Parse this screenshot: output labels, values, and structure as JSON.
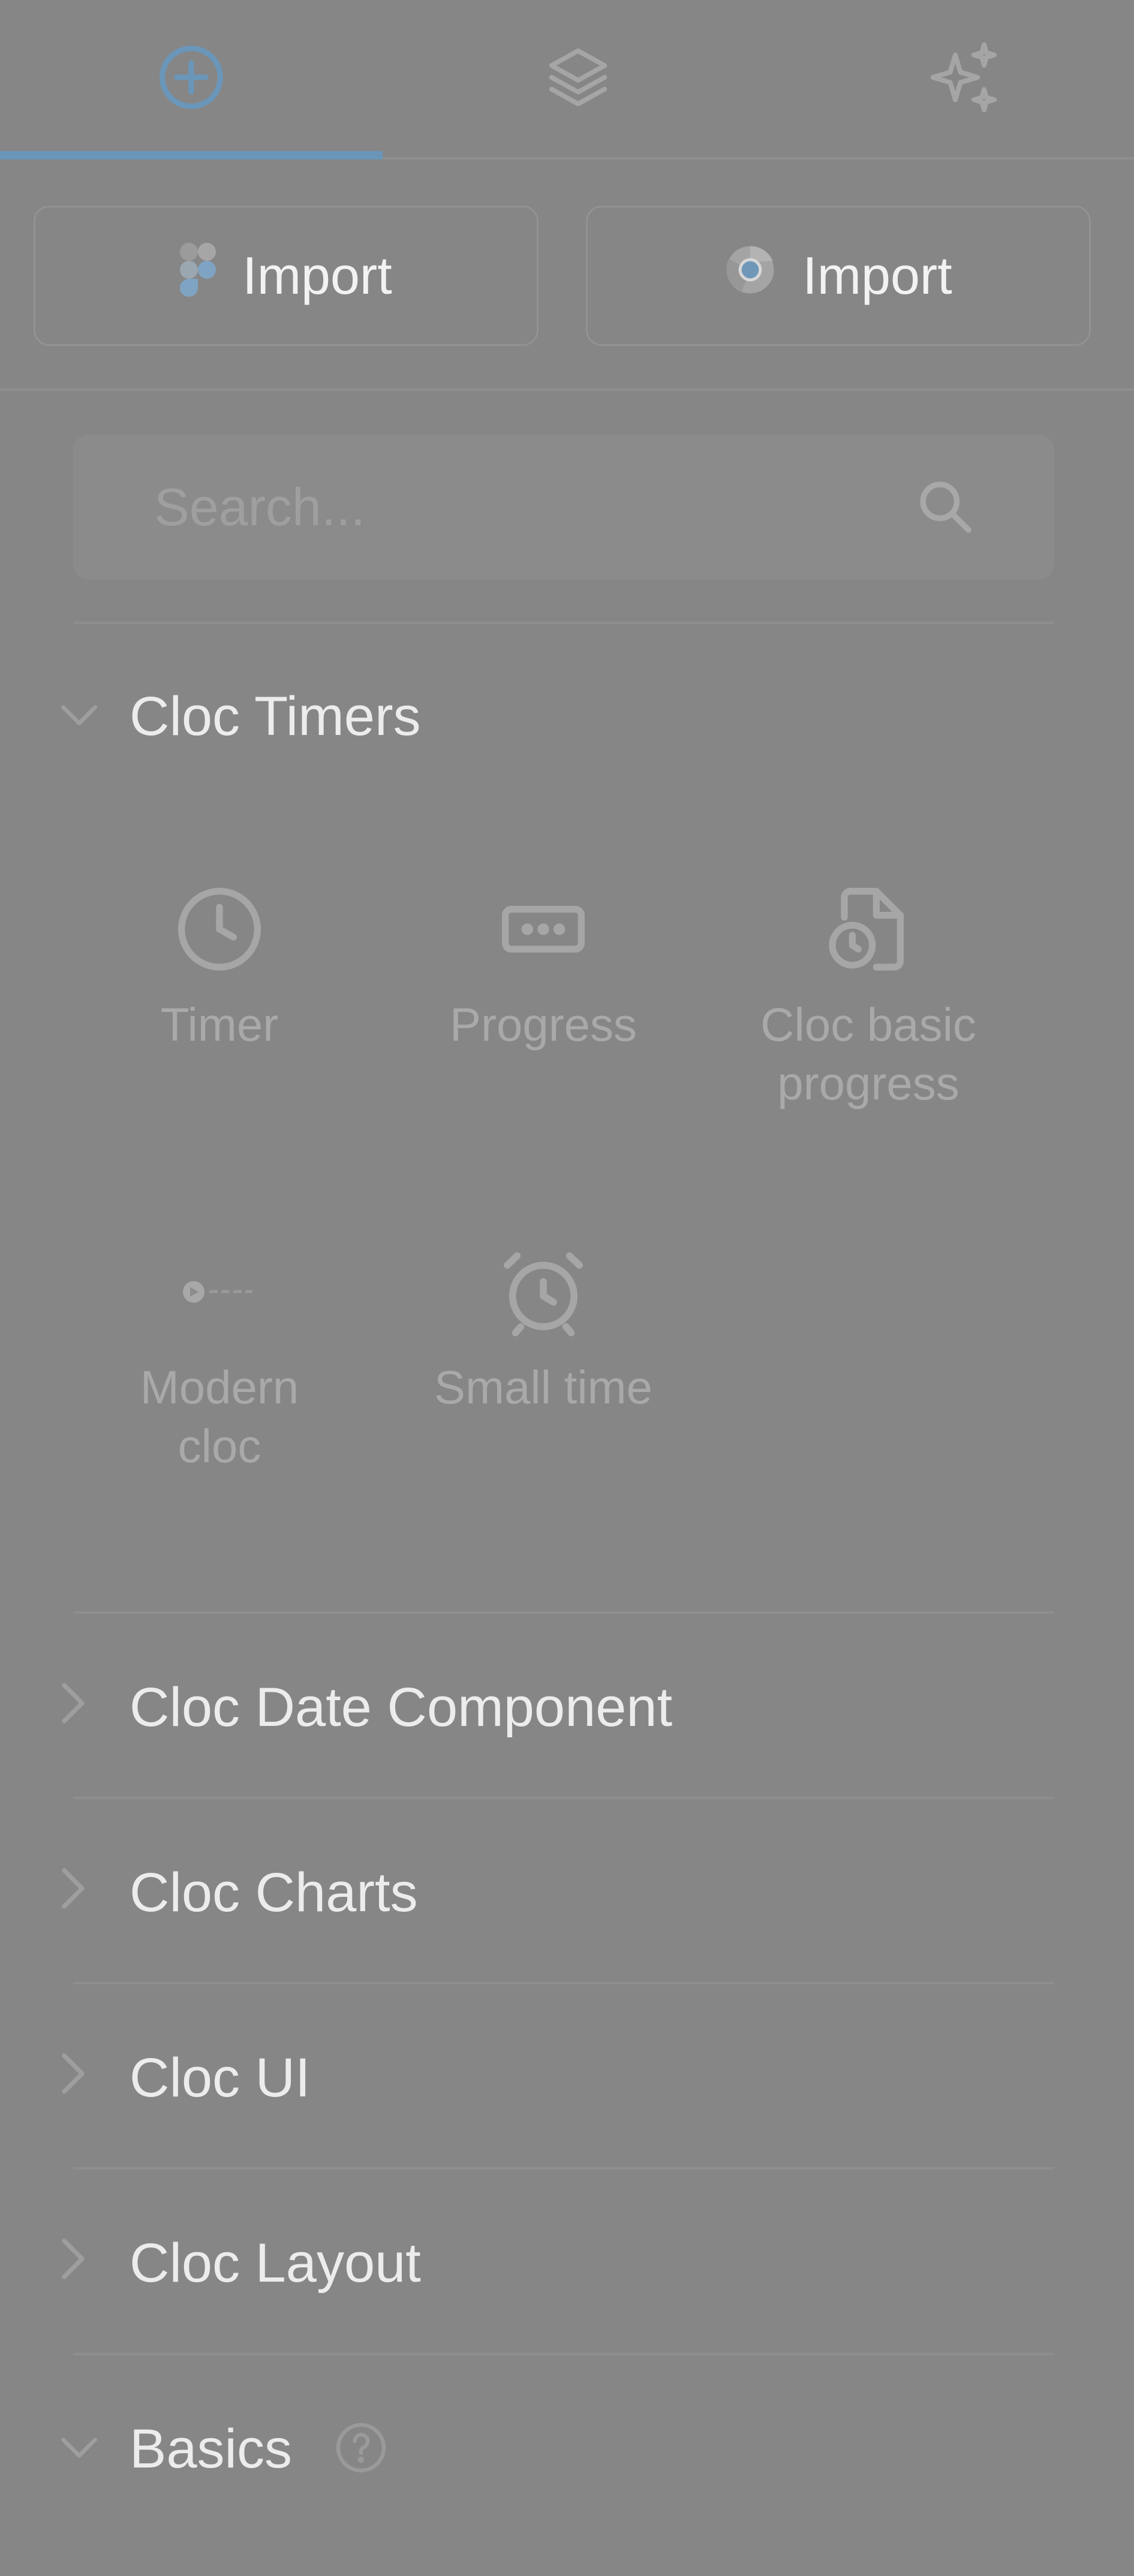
{
  "tabs": [
    {
      "icon": "plus-circle-icon",
      "active": true
    },
    {
      "icon": "layers-icon",
      "active": false
    },
    {
      "icon": "sparkles-icon",
      "active": false
    }
  ],
  "imports": [
    {
      "label": "Import",
      "icon": "figma-icon"
    },
    {
      "label": "Import",
      "icon": "chrome-icon"
    }
  ],
  "search": {
    "placeholder": "Search..."
  },
  "sections": {
    "cloc_timers": {
      "label": "Cloc Timers",
      "expanded": true,
      "items": [
        {
          "label": "Timer",
          "icon": "clock-icon"
        },
        {
          "label": "Progress",
          "icon": "ellipsis-box-icon"
        },
        {
          "label_line1": "Cloc basic",
          "label_line2": "progress",
          "icon": "file-clock-icon"
        },
        {
          "label_line1": "Modern",
          "label_line2": "cloc",
          "icon": "modern-cloc-thumbnail-icon"
        },
        {
          "label": "Small time",
          "icon": "alarm-clock-icon"
        }
      ]
    },
    "cloc_date": {
      "label": "Cloc Date Component",
      "expanded": false
    },
    "cloc_charts": {
      "label": "Cloc Charts",
      "expanded": false
    },
    "cloc_ui": {
      "label": "Cloc UI",
      "expanded": false
    },
    "cloc_layout": {
      "label": "Cloc Layout",
      "expanded": false
    },
    "basics": {
      "label": "Basics",
      "expanded": true,
      "help_icon": "question-circle-icon"
    }
  },
  "colors": {
    "background": "#868686",
    "accent": "#6a96b9",
    "text": "#ececec",
    "muted_text": "#a9a9a9"
  }
}
